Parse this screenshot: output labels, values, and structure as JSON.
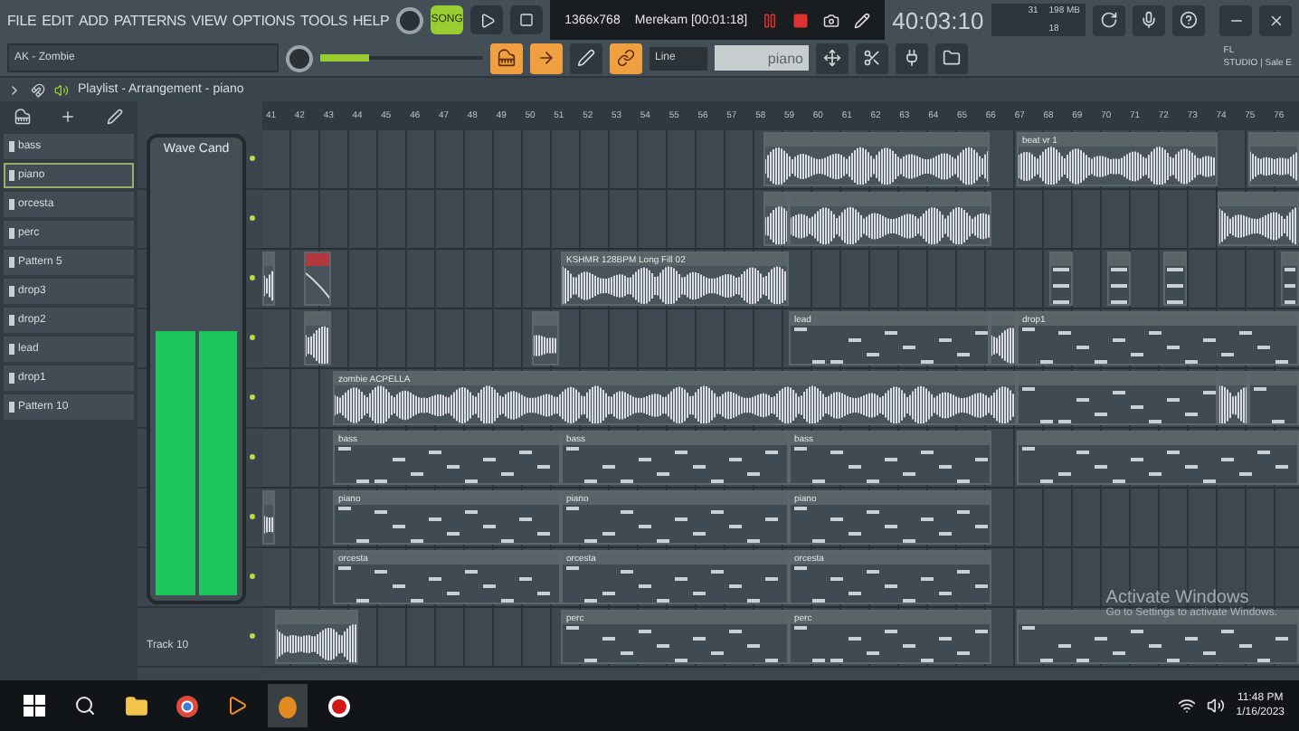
{
  "menu": [
    "FILE",
    "EDIT",
    "ADD",
    "PATTERNS",
    "VIEW",
    "OPTIONS",
    "TOOLS",
    "HELP"
  ],
  "transport": {
    "mode": "SONG",
    "playing": false
  },
  "recorder": {
    "resolution": "1366x768",
    "status": "Merekam [00:01:18]"
  },
  "time": "40:03:10",
  "tempo": {
    "level": 0.3
  },
  "cpu": {
    "value": "31",
    "memory": "198 MB",
    "polyphony": "18"
  },
  "hint": "AK - Zombie",
  "snap": "Line",
  "pattern": "piano",
  "brand": [
    "FL",
    "STUDIO | Sale E"
  ],
  "playlist_title": "Playlist - Arrangement - piano",
  "patterns": [
    {
      "name": "bass",
      "selected": false
    },
    {
      "name": "piano",
      "selected": true
    },
    {
      "name": "orcesta",
      "selected": false
    },
    {
      "name": "perc",
      "selected": false
    },
    {
      "name": "Pattern 5",
      "selected": false
    },
    {
      "name": "drop3",
      "selected": false
    },
    {
      "name": "drop2",
      "selected": false
    },
    {
      "name": "lead",
      "selected": false
    },
    {
      "name": "drop1",
      "selected": false
    },
    {
      "name": "Pattern 10",
      "selected": false
    }
  ],
  "meter": {
    "title": "Wave Cand",
    "level": 0.6
  },
  "track_label": "Track 10",
  "ruler": [
    "41",
    "42",
    "43",
    "44",
    "45",
    "46",
    "47",
    "48",
    "49",
    "50",
    "51",
    "52",
    "53",
    "54",
    "55",
    "56",
    "57",
    "58",
    "59",
    "60",
    "61",
    "62",
    "63",
    "64",
    "65",
    "66",
    "67",
    "68",
    "69",
    "70",
    "71",
    "72",
    "73",
    "74",
    "75",
    "76"
  ],
  "tracks": [
    {
      "clips": [
        {
          "kind": "audio"
        },
        {
          "kind": "audio",
          "label": "beat vr 1"
        },
        {
          "kind": "audio"
        }
      ]
    },
    {
      "clips": [
        {
          "kind": "audio"
        },
        {
          "kind": "audio"
        },
        {
          "kind": "audio"
        }
      ]
    },
    {
      "clips": [
        {
          "kind": "audio"
        },
        {
          "kind": "automation"
        },
        {
          "kind": "audio",
          "label": "KSHMR 128BPM Long Fill 02"
        },
        {
          "kind": "pattern"
        },
        {
          "kind": "pattern"
        },
        {
          "kind": "pattern"
        },
        {
          "kind": "pattern"
        }
      ]
    },
    {
      "clips": [
        {
          "kind": "audio"
        },
        {
          "kind": "audio"
        },
        {
          "kind": "pattern",
          "label": "lead"
        },
        {
          "kind": "audio"
        },
        {
          "kind": "pattern",
          "label": "drop1"
        }
      ]
    },
    {
      "clips": [
        {
          "kind": "audio",
          "label": "zombie ACPELLA"
        },
        {
          "kind": "pattern"
        },
        {
          "kind": "audio"
        },
        {
          "kind": "pattern"
        }
      ]
    },
    {
      "clips": [
        {
          "kind": "pattern",
          "label": "bass"
        },
        {
          "kind": "pattern",
          "label": "bass"
        },
        {
          "kind": "pattern",
          "label": "bass"
        },
        {
          "kind": "pattern"
        }
      ]
    },
    {
      "clips": [
        {
          "kind": "audio"
        },
        {
          "kind": "pattern",
          "label": "piano"
        },
        {
          "kind": "pattern",
          "label": "piano"
        },
        {
          "kind": "pattern",
          "label": "piano"
        }
      ]
    },
    {
      "clips": [
        {
          "kind": "pattern",
          "label": "orcesta"
        },
        {
          "kind": "pattern",
          "label": "orcesta"
        },
        {
          "kind": "pattern",
          "label": "orcesta"
        }
      ]
    },
    {
      "clips": [
        {
          "kind": "audio"
        },
        {
          "kind": "pattern",
          "label": "perc"
        },
        {
          "kind": "pattern",
          "label": "perc"
        },
        {
          "kind": "pattern"
        }
      ]
    }
  ],
  "activation": {
    "title": "Activate Windows",
    "subtitle": "Go to Settings to activate Windows."
  },
  "clock": {
    "time": "11:48 PM",
    "date": "1/16/2023"
  }
}
